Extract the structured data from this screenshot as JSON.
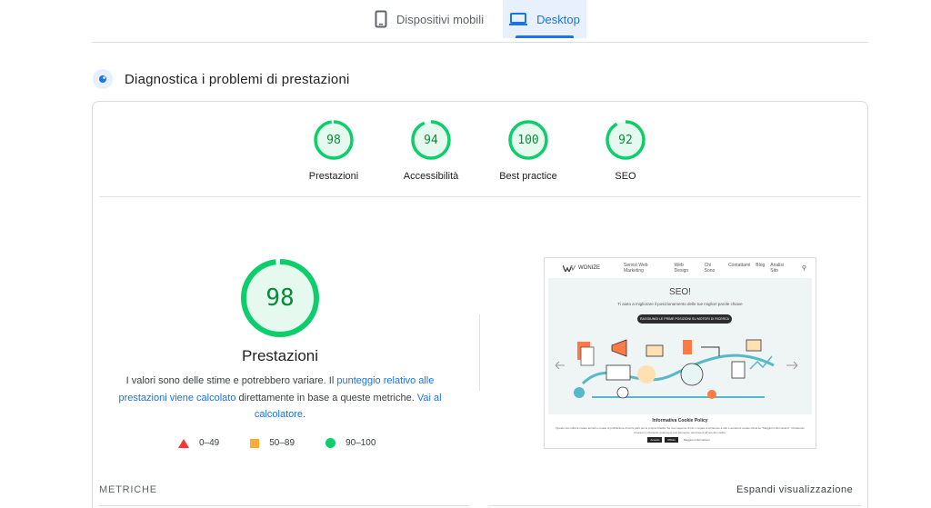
{
  "tabs": {
    "mobile_label": "Dispositivi mobili",
    "desktop_label": "Desktop",
    "active": "desktop"
  },
  "diagnostics": {
    "title": "Diagnostica i problemi di prestazioni",
    "icon": "lighthouse-icon"
  },
  "scores": [
    {
      "value": "98",
      "label": "Prestazioni",
      "score": 98
    },
    {
      "value": "94",
      "label": "Accessibilità",
      "score": 94
    },
    {
      "value": "100",
      "label": "Best practice",
      "score": 100
    },
    {
      "value": "92",
      "label": "SEO",
      "score": 92
    }
  ],
  "performance": {
    "value": "98",
    "score": 98,
    "label": "Prestazioni",
    "desc_1": "I valori sono delle stime e potrebbero variare. Il ",
    "desc_link_1": "punteggio relativo alle prestazioni viene calcolato",
    "desc_2": " direttamente in base a queste metriche. ",
    "desc_link_2": "Vai al calcolatore",
    "desc_3": "."
  },
  "legend": {
    "fail": "0–49",
    "average": "50–89",
    "pass": "90–100"
  },
  "thumbnail": {
    "logo": "WONIZE",
    "nav_items": [
      "Servizi Web Marketing",
      "Web Design",
      "Chi Sono",
      "Contattami",
      "Blog",
      "Analisi Sito"
    ],
    "hero_title": "SEO!",
    "hero_sub": "Ti aiuto a migliorare il posizionamento delle tue migliori parole chiave",
    "hero_button": "RAGGIUNGI LE PRIME POSIZIONI SU MOTORI DI RICERCA",
    "cookie_title": "Informativa Cookie Policy",
    "cookie_text": "Questo sito utilizza cookie tecnici e cookie di profilazione di terze parti per le proprie finalità. Se vuoi saperne di più o negare il consenso a tutti o ad alcuni cookie clicca su \"Maggiori informazioni\". Chiudendo il banner o cliccando qualunque suo elemento, acconsenti all'uso dei cookie.",
    "cookie_buttons": [
      "Accetto",
      "Rifiuto",
      "Maggiori Informazioni"
    ]
  },
  "metrics": {
    "label": "METRICHE",
    "expand": "Espandi visualizzazione"
  },
  "colors": {
    "pass": "#0cce6b",
    "pass_text": "#0a8a3a",
    "average": "#ffaa33",
    "fail": "#ff3333",
    "accent": "#1a73e8"
  }
}
